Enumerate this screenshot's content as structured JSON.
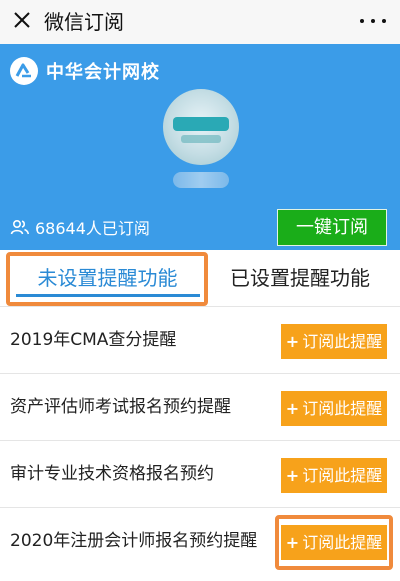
{
  "topbar": {
    "title": "微信订阅",
    "close_icon": "close-icon",
    "more_icon": "more-dots-icon"
  },
  "account": {
    "name": "中华会计网校",
    "logo_icon": "chinaacc-logo-icon",
    "subscriber_text": "68644人已订阅",
    "subscriber_icon": "people-icon",
    "subscribe_all_label": "一键订阅"
  },
  "tabs": [
    {
      "label": "未设置提醒功能",
      "active": true
    },
    {
      "label": "已设置提醒功能",
      "active": false
    }
  ],
  "items": [
    {
      "title": "2019年CMA查分提醒",
      "button": "订阅此提醒",
      "button_icon": "+"
    },
    {
      "title": "资产评估师考试报名预约提醒",
      "button": "订阅此提醒",
      "button_icon": "+"
    },
    {
      "title": "审计专业技术资格报名预约",
      "button": "订阅此提醒",
      "button_icon": "+"
    },
    {
      "title": "2020年注册会计师报名预约提醒",
      "button": "订阅此提醒",
      "button_icon": "+",
      "highlighted": true
    }
  ],
  "colors": {
    "hero_blue": "#3b9ce8",
    "accent_blue": "#2a8ad5",
    "subscribe_green": "#1aad19",
    "item_button_orange": "#f7a21b",
    "highlight_orange": "#f08a3c"
  }
}
